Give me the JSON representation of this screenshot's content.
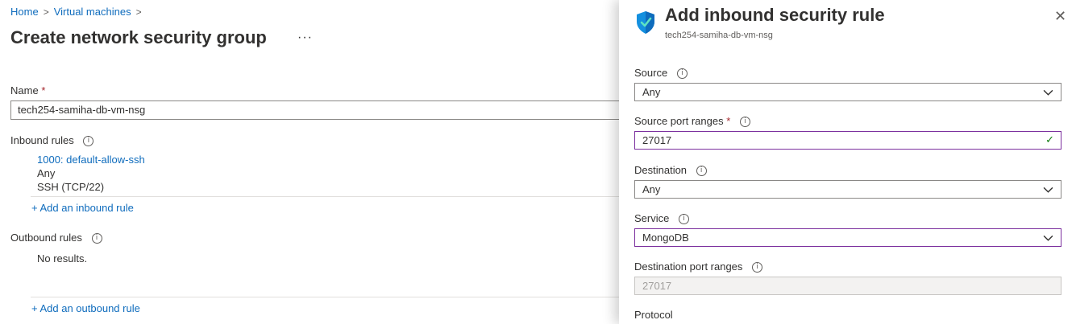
{
  "breadcrumb": {
    "home": "Home",
    "virtual_machines": "Virtual machines",
    "sep": ">"
  },
  "page": {
    "title": "Create network security group",
    "more": "···",
    "name_label": "Name",
    "required_mark": "*",
    "name_value": "tech254-samiha-db-vm-nsg",
    "inbound_label": "Inbound rules",
    "inbound_rule": {
      "link": "1000: default-allow-ssh",
      "source": "Any",
      "service": "SSH (TCP/22)"
    },
    "add_inbound": "+ Add an inbound rule",
    "outbound_label": "Outbound rules",
    "outbound_empty": "No results.",
    "add_outbound": "+ Add an outbound rule"
  },
  "blade": {
    "title": "Add inbound security rule",
    "subtitle": "tech254-samiha-db-vm-nsg",
    "close": "✕",
    "fields": {
      "source": {
        "label": "Source",
        "value": "Any"
      },
      "source_ports": {
        "label": "Source port ranges",
        "value": "27017"
      },
      "destination": {
        "label": "Destination",
        "value": "Any"
      },
      "service": {
        "label": "Service",
        "value": "MongoDB"
      },
      "dest_ports": {
        "label": "Destination port ranges",
        "value": "27017"
      },
      "protocol": {
        "label": "Protocol"
      }
    }
  },
  "colors": {
    "link": "#0f6cbd",
    "focus_border": "#7b2f9e",
    "valid_check": "#107c10",
    "required": "#a4262c"
  },
  "icons": {
    "info": "i",
    "check": "✓",
    "shield": "shield-icon",
    "chevron": "chevron-down-icon"
  }
}
